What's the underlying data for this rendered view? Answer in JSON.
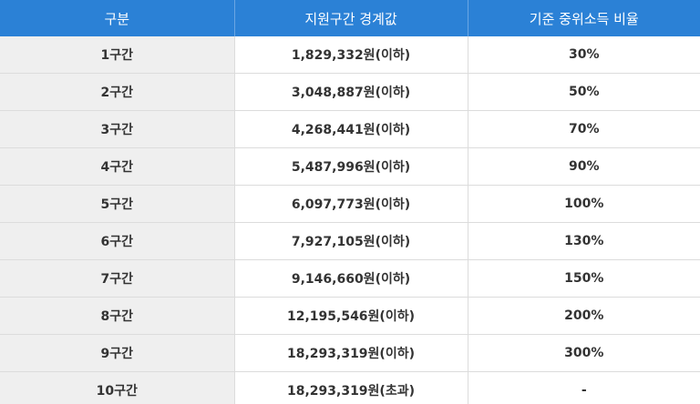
{
  "table": {
    "headers": [
      "구분",
      "지원구간 경계값",
      "기준 중위소득 비율"
    ],
    "rows": [
      [
        "1구간",
        "1,829,332원(이하)",
        "30%"
      ],
      [
        "2구간",
        "3,048,887원(이하)",
        "50%"
      ],
      [
        "3구간",
        "4,268,441원(이하)",
        "70%"
      ],
      [
        "4구간",
        "5,487,996원(이하)",
        "90%"
      ],
      [
        "5구간",
        "6,097,773원(이하)",
        "100%"
      ],
      [
        "6구간",
        "7,927,105원(이하)",
        "130%"
      ],
      [
        "7구간",
        "9,146,660원(이하)",
        "150%"
      ],
      [
        "8구간",
        "12,195,546원(이하)",
        "200%"
      ],
      [
        "9구간",
        "18,293,319원(이하)",
        "300%"
      ],
      [
        "10구간",
        "18,293,319원(초과)",
        "-"
      ]
    ]
  }
}
